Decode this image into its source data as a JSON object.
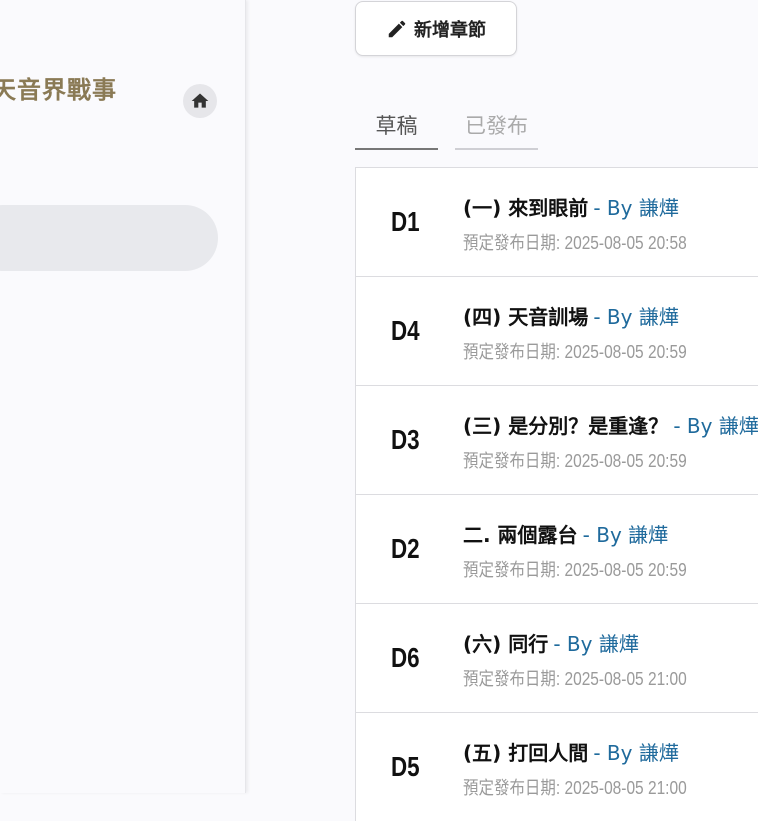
{
  "sidebar": {
    "book_title": "天音界戰事",
    "home_icon": "home-icon"
  },
  "toolbar": {
    "add_chapter_label": "新增章節",
    "add_icon": "pencil-icon"
  },
  "tabs": [
    {
      "label": "草稿",
      "active": true
    },
    {
      "label": "已發布",
      "active": false
    }
  ],
  "chapters": [
    {
      "code": "D1",
      "title": "(一) 來到眼前",
      "author": "- By 謙燁",
      "date": "預定發布日期: 2025-08-05 20:58"
    },
    {
      "code": "D4",
      "title": "(四) 天音訓場",
      "author": "- By 謙燁",
      "date": "預定發布日期: 2025-08-05 20:59"
    },
    {
      "code": "D3",
      "title": "(三) 是分別？是重逢？",
      "author": "- By 謙燁",
      "date": "預定發布日期: 2025-08-05 20:59"
    },
    {
      "code": "D2",
      "title": "二. 兩個露台",
      "author": "- By 謙燁",
      "date": "預定發布日期: 2025-08-05 20:59"
    },
    {
      "code": "D6",
      "title": "(六) 同行",
      "author": "- By 謙燁",
      "date": "預定發布日期: 2025-08-05 21:00"
    },
    {
      "code": "D5",
      "title": "(五) 打回人間",
      "author": "- By 謙燁",
      "date": "預定發布日期: 2025-08-05 21:00"
    }
  ]
}
